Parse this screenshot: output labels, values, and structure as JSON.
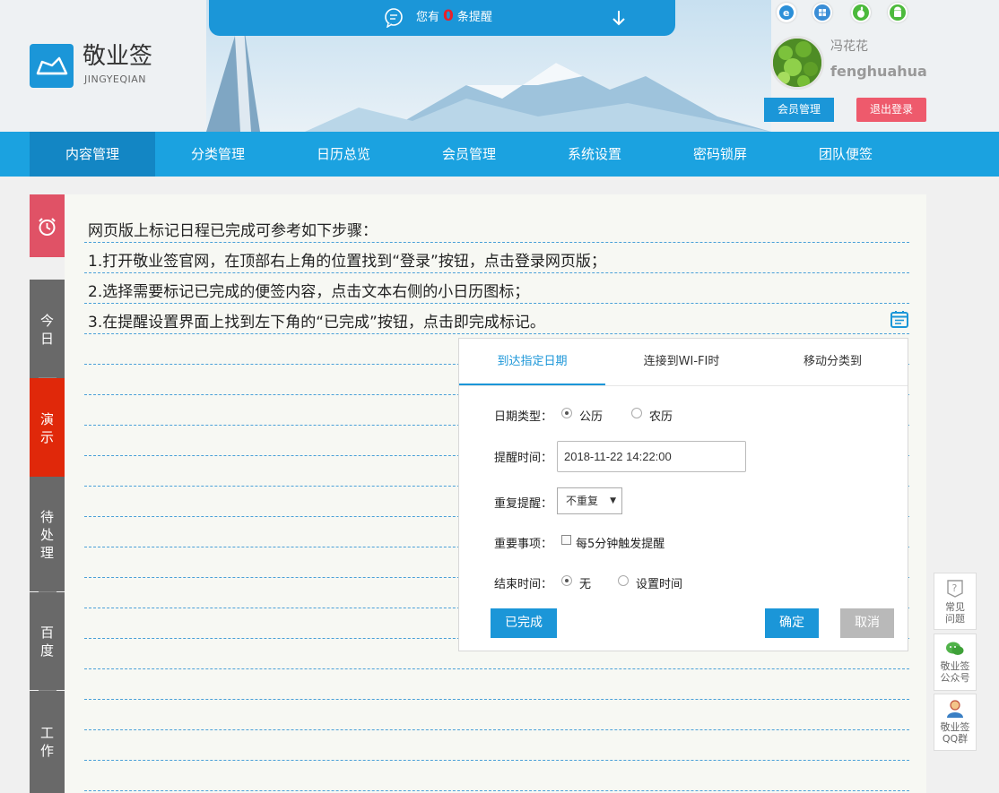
{
  "notice": {
    "prefix": "您有",
    "count": "0",
    "suffix": "条提醒"
  },
  "brand": {
    "name": "敬业签",
    "sub": "JINGYEQIAN"
  },
  "platforms": [
    "ie-icon",
    "windows-icon",
    "apple-icon",
    "android-icon"
  ],
  "user": {
    "name_cn": "冯花花",
    "name_en": "fenghuahua",
    "member_btn": "会员管理",
    "logout_btn": "退出登录"
  },
  "nav": [
    "内容管理",
    "分类管理",
    "日历总览",
    "会员管理",
    "系统设置",
    "密码锁屏",
    "团队便签"
  ],
  "sidebar": {
    "tabs": [
      "今日",
      "演示",
      "待处理",
      "百度",
      "工作"
    ]
  },
  "note": {
    "lines": [
      "网页版上标记日程已完成可参考如下步骤：",
      "1.打开敬业签官网，在顶部右上角的位置找到“登录”按钮，点击登录网页版；",
      "2.选择需要标记已完成的便签内容，点击文本右侧的小日历图标；",
      "3.在提醒设置界面上找到左下角的“已完成”按钮，点击即完成标记。"
    ]
  },
  "popup": {
    "tabs": [
      "到达指定日期",
      "连接到WI-FI时",
      "移动分类到"
    ],
    "date_type_label": "日期类型：",
    "date_type_options": [
      "公历",
      "农历"
    ],
    "remind_time_label": "提醒时间：",
    "remind_time_value": "2018-11-22 14:22:00",
    "repeat_label": "重复提醒：",
    "repeat_value": "不重复",
    "important_label": "重要事项：",
    "important_option": "每5分钟触发提醒",
    "end_label": "结束时间：",
    "end_options": [
      "无",
      "设置时间"
    ],
    "done_btn": "已完成",
    "ok_btn": "确定",
    "cancel_btn": "取消"
  },
  "float": {
    "faq": [
      "常见",
      "问题"
    ],
    "wechat": [
      "敬业签",
      "公众号"
    ],
    "qq": [
      "敬业签",
      "QQ群"
    ]
  },
  "colors": {
    "primary": "#1b96d8",
    "nav": "#1ba2e0",
    "danger": "#ee5a6c",
    "active_tab": "#e0280a"
  }
}
